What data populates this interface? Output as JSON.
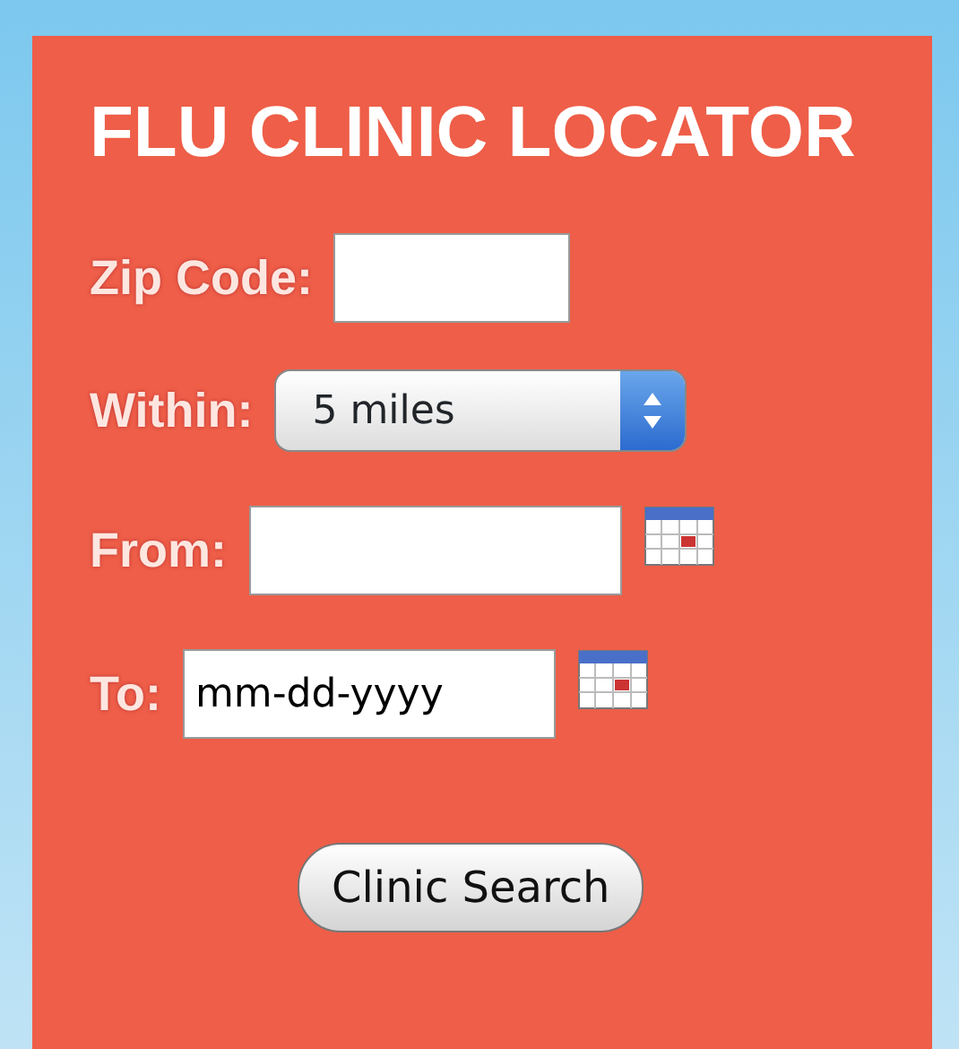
{
  "title": "FLU CLINIC LOCATOR",
  "fields": [
    {
      "kind": "text",
      "label": "Zip Code:"
    },
    {
      "kind": "select",
      "label": "Within:",
      "value": "5 miles"
    },
    {
      "kind": "date",
      "label": "From:"
    },
    {
      "kind": "date",
      "label": "To:",
      "value": "mm-dd-yyyy"
    }
  ],
  "button": "Clinic Search"
}
